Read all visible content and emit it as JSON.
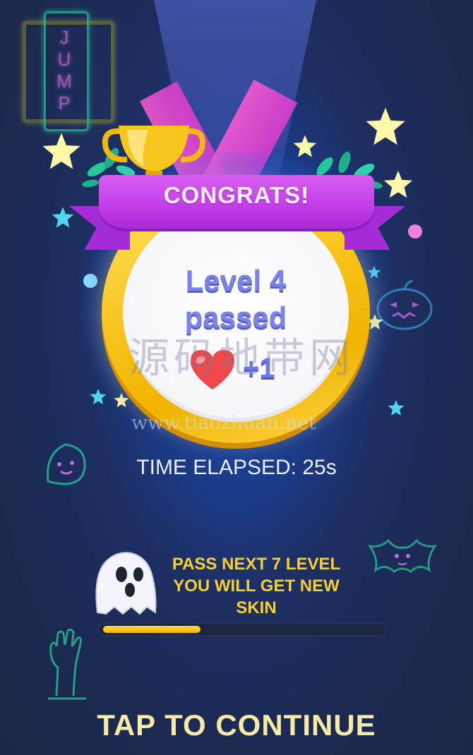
{
  "sign": {
    "text": "JUMP"
  },
  "medal": {
    "banner": "CONGRATS!",
    "level_line1": "Level 4",
    "level_line2": "passed",
    "reward": "+1",
    "reward_icon": "heart-icon"
  },
  "watermark": {
    "cn": "源码地带网",
    "url": "www.tiaozhuan.net"
  },
  "time_elapsed": "TIME ELAPSED: 25s",
  "skin_progress": {
    "text_line1": "PASS NEXT 7 LEVEL",
    "text_line2": "YOU WILL GET NEW",
    "text_line3": "SKIN",
    "progress": 0.35
  },
  "tap_to_continue": "TAP TO CONTINUE",
  "colors": {
    "accent_yellow": "#f7cf2e",
    "ribbon": "#c13de8",
    "level_text": "#7b83e8"
  }
}
